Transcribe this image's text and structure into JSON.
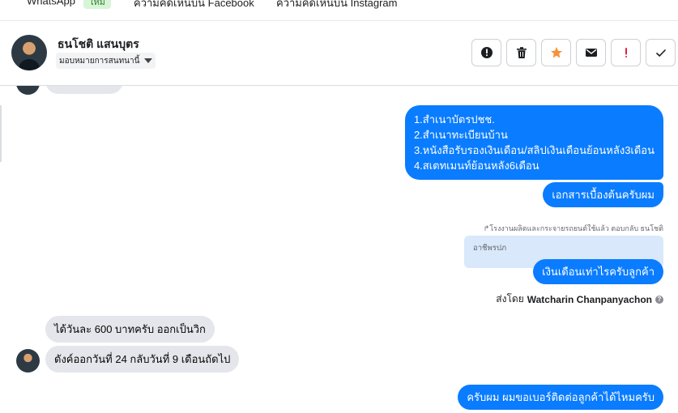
{
  "tabs": [
    {
      "label": "WhatsApp",
      "badge": "ใหม่"
    },
    {
      "label": "ความคิดเห็นบน Facebook"
    },
    {
      "label": "ความคิดเห็นบน Instagram"
    }
  ],
  "contact": {
    "name": "ธนโชติ แสนบุตร",
    "assign_label": "มอบหมายการสนทนานี้"
  },
  "actions": [
    {
      "name": "alert-icon"
    },
    {
      "name": "trash-icon"
    },
    {
      "name": "star-icon",
      "color": "#f7923a"
    },
    {
      "name": "mail-icon"
    },
    {
      "name": "exclamation-icon",
      "color": "#e41e3f"
    },
    {
      "name": "check-icon"
    }
  ],
  "messages": {
    "docs_list": [
      "1.สำเนาบัตรปชช.",
      "2.สำเนาทะเบียนบ้าน",
      "3.หนังสือรับรองเงินเดือน/สลิปเงินเดือนย้อนหลัง3เดือน",
      "4.สเตทเมนท์ย้อนหลัง6เดือน"
    ],
    "docs_note": "เอกสารเบื้องต้นครับผม",
    "reply_meta": "โรงงานผลิตและกระจายรถยนต์ใช้แล้ว ตอบกลับ ธนโชติ",
    "quoted_text": "อาชีพรปภ",
    "salary_question": "เงินเดือนเท่าไรครับลูกค้า",
    "sent_by_prefix": "ส่งโดย",
    "sent_by_name": "Watcharin Chanpanyachon",
    "in_salary": "ได้วันละ 600 บาทครับ  ออกเป็นวิก",
    "in_payday": "ดังค์ออกวันที่ 24  กลับวันที่ 9 เดือนถัดไป",
    "ask_phone": "ครับผม ผมขอเบอร์ติดต่อลูกค้าได้ไหมครับ"
  },
  "colors": {
    "outgoing": "#0a7cff",
    "incoming": "#e4e6eb",
    "quote_bg": "#d9e8fb"
  }
}
